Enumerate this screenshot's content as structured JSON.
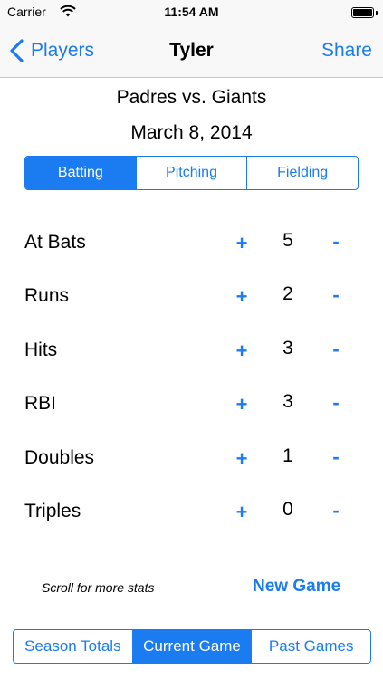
{
  "status_bar": {
    "carrier": "Carrier",
    "time": "11:54 AM",
    "wifi_icon": "wifi-icon",
    "battery_icon": "battery-icon",
    "battery_level": 1.0
  },
  "nav": {
    "back_label": "Players",
    "back_icon": "chevron-left-icon",
    "title": "Tyler",
    "share_label": "Share"
  },
  "game": {
    "title": "Padres vs. Giants",
    "date": "March 8, 2014"
  },
  "stat_tabs": {
    "items": [
      {
        "label": "Batting",
        "selected": true
      },
      {
        "label": "Pitching",
        "selected": false
      },
      {
        "label": "Fielding",
        "selected": false
      }
    ]
  },
  "stats": [
    {
      "label": "At Bats",
      "plus": "+",
      "value": "5",
      "minus": "-"
    },
    {
      "label": "Runs",
      "plus": "+",
      "value": "2",
      "minus": "-"
    },
    {
      "label": "Hits",
      "plus": "+",
      "value": "3",
      "minus": "-"
    },
    {
      "label": "RBI",
      "plus": "+",
      "value": "3",
      "minus": "-"
    },
    {
      "label": "Doubles",
      "plus": "+",
      "value": "1",
      "minus": "-"
    },
    {
      "label": "Triples",
      "plus": "+",
      "value": "0",
      "minus": "-"
    }
  ],
  "footer": {
    "scroll_hint": "Scroll for more stats",
    "new_game_label": "New Game"
  },
  "view_tabs": {
    "items": [
      {
        "label": "Season Totals",
        "selected": false
      },
      {
        "label": "Current Game",
        "selected": true
      },
      {
        "label": "Past Games",
        "selected": false
      }
    ]
  },
  "colors": {
    "accent": "#1a7cf0",
    "bar_background": "#f8f8f8",
    "separator": "#c8c7cc"
  }
}
